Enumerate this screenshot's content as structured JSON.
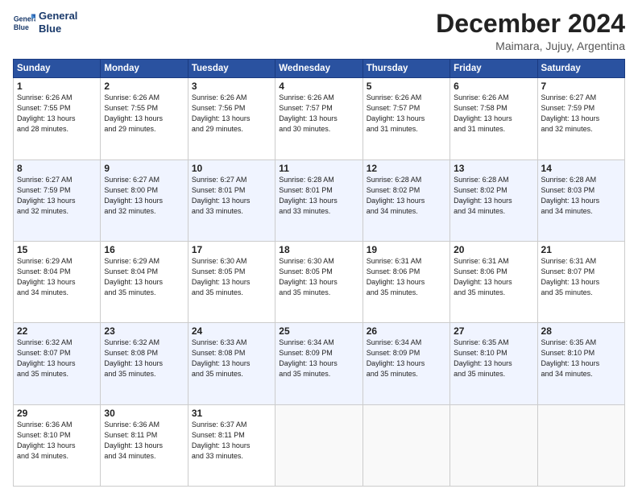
{
  "header": {
    "logo_line1": "General",
    "logo_line2": "Blue",
    "month": "December 2024",
    "location": "Maimara, Jujuy, Argentina"
  },
  "weekdays": [
    "Sunday",
    "Monday",
    "Tuesday",
    "Wednesday",
    "Thursday",
    "Friday",
    "Saturday"
  ],
  "weeks": [
    [
      {
        "day": "1",
        "lines": [
          "Sunrise: 6:26 AM",
          "Sunset: 7:55 PM",
          "Daylight: 13 hours",
          "and 28 minutes."
        ]
      },
      {
        "day": "2",
        "lines": [
          "Sunrise: 6:26 AM",
          "Sunset: 7:55 PM",
          "Daylight: 13 hours",
          "and 29 minutes."
        ]
      },
      {
        "day": "3",
        "lines": [
          "Sunrise: 6:26 AM",
          "Sunset: 7:56 PM",
          "Daylight: 13 hours",
          "and 29 minutes."
        ]
      },
      {
        "day": "4",
        "lines": [
          "Sunrise: 6:26 AM",
          "Sunset: 7:57 PM",
          "Daylight: 13 hours",
          "and 30 minutes."
        ]
      },
      {
        "day": "5",
        "lines": [
          "Sunrise: 6:26 AM",
          "Sunset: 7:57 PM",
          "Daylight: 13 hours",
          "and 31 minutes."
        ]
      },
      {
        "day": "6",
        "lines": [
          "Sunrise: 6:26 AM",
          "Sunset: 7:58 PM",
          "Daylight: 13 hours",
          "and 31 minutes."
        ]
      },
      {
        "day": "7",
        "lines": [
          "Sunrise: 6:27 AM",
          "Sunset: 7:59 PM",
          "Daylight: 13 hours",
          "and 32 minutes."
        ]
      }
    ],
    [
      {
        "day": "8",
        "lines": [
          "Sunrise: 6:27 AM",
          "Sunset: 7:59 PM",
          "Daylight: 13 hours",
          "and 32 minutes."
        ]
      },
      {
        "day": "9",
        "lines": [
          "Sunrise: 6:27 AM",
          "Sunset: 8:00 PM",
          "Daylight: 13 hours",
          "and 32 minutes."
        ]
      },
      {
        "day": "10",
        "lines": [
          "Sunrise: 6:27 AM",
          "Sunset: 8:01 PM",
          "Daylight: 13 hours",
          "and 33 minutes."
        ]
      },
      {
        "day": "11",
        "lines": [
          "Sunrise: 6:28 AM",
          "Sunset: 8:01 PM",
          "Daylight: 13 hours",
          "and 33 minutes."
        ]
      },
      {
        "day": "12",
        "lines": [
          "Sunrise: 6:28 AM",
          "Sunset: 8:02 PM",
          "Daylight: 13 hours",
          "and 34 minutes."
        ]
      },
      {
        "day": "13",
        "lines": [
          "Sunrise: 6:28 AM",
          "Sunset: 8:02 PM",
          "Daylight: 13 hours",
          "and 34 minutes."
        ]
      },
      {
        "day": "14",
        "lines": [
          "Sunrise: 6:28 AM",
          "Sunset: 8:03 PM",
          "Daylight: 13 hours",
          "and 34 minutes."
        ]
      }
    ],
    [
      {
        "day": "15",
        "lines": [
          "Sunrise: 6:29 AM",
          "Sunset: 8:04 PM",
          "Daylight: 13 hours",
          "and 34 minutes."
        ]
      },
      {
        "day": "16",
        "lines": [
          "Sunrise: 6:29 AM",
          "Sunset: 8:04 PM",
          "Daylight: 13 hours",
          "and 35 minutes."
        ]
      },
      {
        "day": "17",
        "lines": [
          "Sunrise: 6:30 AM",
          "Sunset: 8:05 PM",
          "Daylight: 13 hours",
          "and 35 minutes."
        ]
      },
      {
        "day": "18",
        "lines": [
          "Sunrise: 6:30 AM",
          "Sunset: 8:05 PM",
          "Daylight: 13 hours",
          "and 35 minutes."
        ]
      },
      {
        "day": "19",
        "lines": [
          "Sunrise: 6:31 AM",
          "Sunset: 8:06 PM",
          "Daylight: 13 hours",
          "and 35 minutes."
        ]
      },
      {
        "day": "20",
        "lines": [
          "Sunrise: 6:31 AM",
          "Sunset: 8:06 PM",
          "Daylight: 13 hours",
          "and 35 minutes."
        ]
      },
      {
        "day": "21",
        "lines": [
          "Sunrise: 6:31 AM",
          "Sunset: 8:07 PM",
          "Daylight: 13 hours",
          "and 35 minutes."
        ]
      }
    ],
    [
      {
        "day": "22",
        "lines": [
          "Sunrise: 6:32 AM",
          "Sunset: 8:07 PM",
          "Daylight: 13 hours",
          "and 35 minutes."
        ]
      },
      {
        "day": "23",
        "lines": [
          "Sunrise: 6:32 AM",
          "Sunset: 8:08 PM",
          "Daylight: 13 hours",
          "and 35 minutes."
        ]
      },
      {
        "day": "24",
        "lines": [
          "Sunrise: 6:33 AM",
          "Sunset: 8:08 PM",
          "Daylight: 13 hours",
          "and 35 minutes."
        ]
      },
      {
        "day": "25",
        "lines": [
          "Sunrise: 6:34 AM",
          "Sunset: 8:09 PM",
          "Daylight: 13 hours",
          "and 35 minutes."
        ]
      },
      {
        "day": "26",
        "lines": [
          "Sunrise: 6:34 AM",
          "Sunset: 8:09 PM",
          "Daylight: 13 hours",
          "and 35 minutes."
        ]
      },
      {
        "day": "27",
        "lines": [
          "Sunrise: 6:35 AM",
          "Sunset: 8:10 PM",
          "Daylight: 13 hours",
          "and 35 minutes."
        ]
      },
      {
        "day": "28",
        "lines": [
          "Sunrise: 6:35 AM",
          "Sunset: 8:10 PM",
          "Daylight: 13 hours",
          "and 34 minutes."
        ]
      }
    ],
    [
      {
        "day": "29",
        "lines": [
          "Sunrise: 6:36 AM",
          "Sunset: 8:10 PM",
          "Daylight: 13 hours",
          "and 34 minutes."
        ]
      },
      {
        "day": "30",
        "lines": [
          "Sunrise: 6:36 AM",
          "Sunset: 8:11 PM",
          "Daylight: 13 hours",
          "and 34 minutes."
        ]
      },
      {
        "day": "31",
        "lines": [
          "Sunrise: 6:37 AM",
          "Sunset: 8:11 PM",
          "Daylight: 13 hours",
          "and 33 minutes."
        ]
      },
      null,
      null,
      null,
      null
    ]
  ]
}
